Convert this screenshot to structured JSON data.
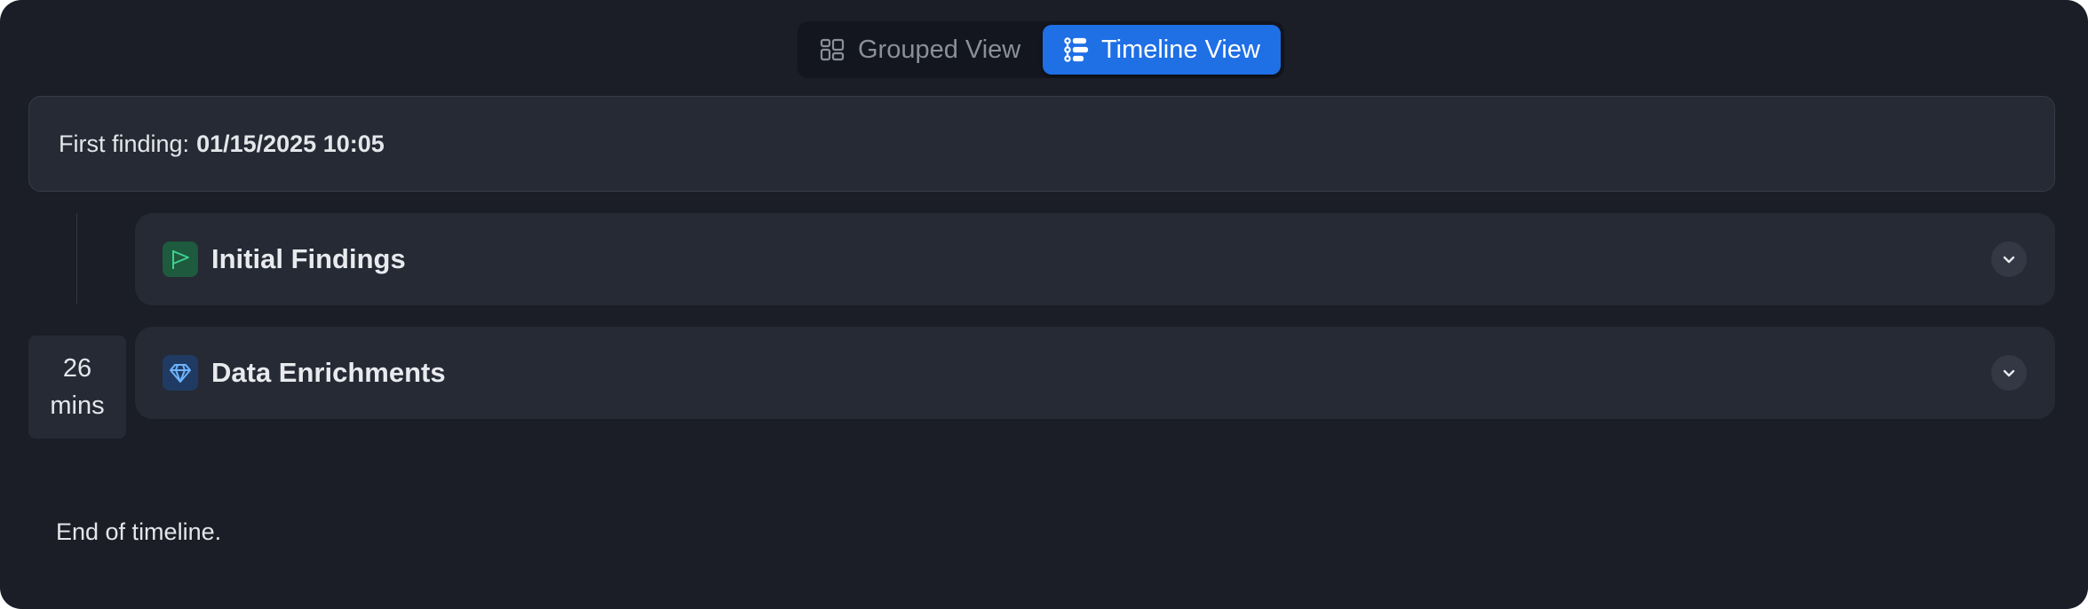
{
  "view_toggle": {
    "grouped": {
      "label": "Grouped View",
      "icon": "grouped-grid-icon",
      "active": false
    },
    "timeline": {
      "label": "Timeline View",
      "icon": "timeline-list-icon",
      "active": true
    }
  },
  "first_finding": {
    "label": "First finding:",
    "value": "01/15/2025 10:05"
  },
  "timeline": {
    "duration_value": "26",
    "duration_unit": "mins"
  },
  "sections": [
    {
      "title": "Initial Findings",
      "icon": "flag-icon",
      "icon_color": "#3ecf8e",
      "expanded": false
    },
    {
      "title": "Data Enrichments",
      "icon": "gem-icon",
      "icon_color": "#6fb3ff",
      "expanded": false
    }
  ],
  "footer": {
    "end_text": "End of timeline."
  },
  "colors": {
    "background": "#1b1e27",
    "card": "#262a35",
    "accent": "#1f6fe5"
  }
}
